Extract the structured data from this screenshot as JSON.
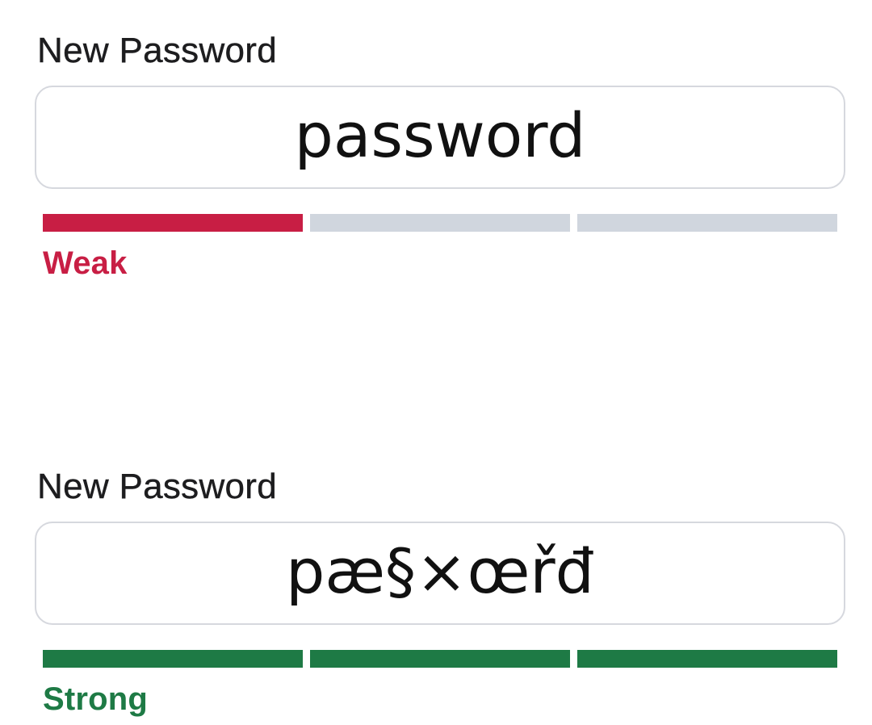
{
  "colors": {
    "weak": "#c81e44",
    "strong": "#1e7a45",
    "empty": "#d0d6de"
  },
  "forms": [
    {
      "label": "New Password",
      "value": "password",
      "strength": "Weak",
      "strength_color": "#c81e44",
      "strength_level": 1,
      "strength_max": 3
    },
    {
      "label": "New Password",
      "value": "pæ§×œřđ",
      "strength": "Strong",
      "strength_color": "#1e7a45",
      "strength_level": 3,
      "strength_max": 3
    }
  ]
}
